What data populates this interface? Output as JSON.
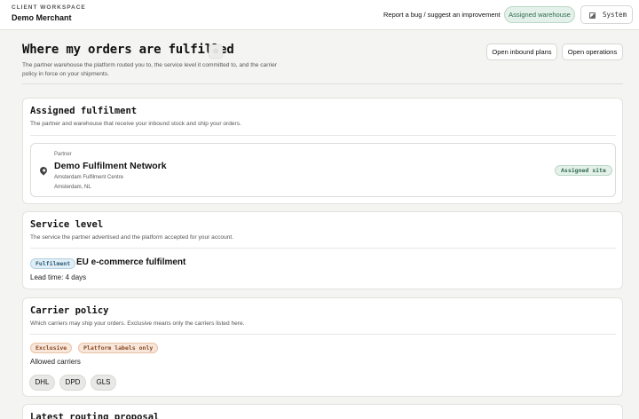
{
  "header": {
    "workspace_label": "CLIENT WORKSPACE",
    "workspace_name": "Demo Merchant",
    "report_link": "Report a bug / suggest an improvement",
    "assigned_tab": "Assigned warehouse",
    "system_label": "System",
    "system_icon": "theme-toggle-icon"
  },
  "page": {
    "title": "Where my orders are fulfilled",
    "star_icon": "star-icon",
    "subtitle": "The partner warehouse the platform routed you to, the service level it committed to, and the carrier policy in force on your shipments.",
    "open_inbound": "Open inbound plans",
    "open_operations": "Open operations"
  },
  "assigned": {
    "title": "Assigned fulfilment",
    "subtitle": "The partner and warehouse that receive your inbound stock and ship your orders.",
    "partner_label": "Partner",
    "partner_name": "Demo Fulfilment Network",
    "site_name": "Amsterdam Fulfilment Centre",
    "site_location": "Amsterdam, NL",
    "site_badge": "Assigned site",
    "location_icon": "map-pin-icon"
  },
  "service": {
    "title": "Service level",
    "subtitle": "The service the partner advertised and the platform accepted for your account.",
    "badge": "Fulfilment",
    "name": "EU e-commerce fulfilment",
    "lead_time": "Lead time: 4 days"
  },
  "carrier": {
    "title": "Carrier policy",
    "subtitle": "Which carriers may ship your orders. Exclusive means only the carriers listed here.",
    "badge_exclusive": "Exclusive",
    "badge_labels": "Platform labels only",
    "allowed_label": "Allowed carriers",
    "carriers": [
      "DHL",
      "DPD",
      "GLS"
    ]
  },
  "routing": {
    "title": "Latest routing proposal"
  },
  "colors": {
    "accent_green": "#2e6b4c",
    "badge_blue": "#2a5a78",
    "badge_orange": "#8a4a22",
    "background": "#f4f4f2"
  }
}
